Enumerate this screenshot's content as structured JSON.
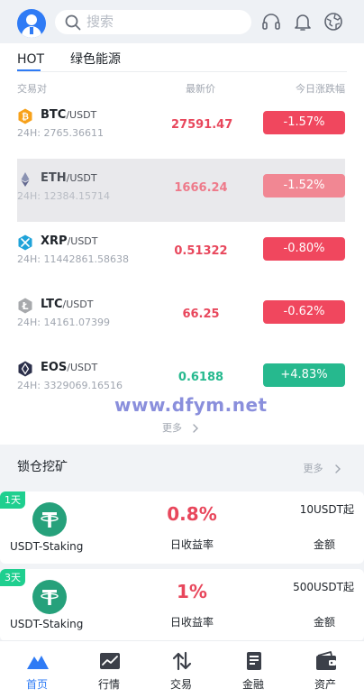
{
  "header": {
    "search_placeholder": "搜索",
    "icons": [
      "avatar",
      "search-icon",
      "headset-icon",
      "bell-icon",
      "globe-icon"
    ]
  },
  "market": {
    "tabs": [
      {
        "label": "HOT",
        "active": true
      },
      {
        "label": "绿色能源",
        "active": false
      }
    ],
    "columns": {
      "pair": "交易对",
      "price": "最新价",
      "change": "今日涨跌幅"
    },
    "rows": [
      {
        "symbol": "BTC",
        "quote": "/USDT",
        "volume": "24H: 2765.36611",
        "price": "27591.47",
        "change": "-1.57%",
        "direction": "down",
        "icon_color": "#f7a11a"
      },
      {
        "symbol": "ETH",
        "quote": "/USDT",
        "volume": "24H: 12384.15714",
        "price": "1666.24",
        "change": "-1.52%",
        "direction": "down",
        "icon_color": "#8a92b2"
      },
      {
        "symbol": "XRP",
        "quote": "/USDT",
        "volume": "24H: 11442861.58638",
        "price": "0.51322",
        "change": "-0.80%",
        "direction": "down",
        "icon_color": "#1fa3d9"
      },
      {
        "symbol": "LTC",
        "quote": "/USDT",
        "volume": "24H: 14161.07399",
        "price": "66.25",
        "change": "-0.62%",
        "direction": "down",
        "icon_color": "#a7a9ac"
      },
      {
        "symbol": "EOS",
        "quote": "/USDT",
        "volume": "24H: 3329069.16516",
        "price": "0.6188",
        "change": "+4.83%",
        "direction": "up",
        "icon_color": "#2b2f4a"
      }
    ],
    "more_label": "更多",
    "watermark": "www.dfym.net"
  },
  "staking": {
    "title": "锁仓挖矿",
    "more_label": "更多",
    "items": [
      {
        "tag": "1天",
        "name": "USDT-Staking",
        "rate": "0.8%",
        "rate_label": "日收益率",
        "min": "10USDT起",
        "min_label": "金额"
      },
      {
        "tag": "3天",
        "name": "USDT-Staking",
        "rate": "1%",
        "rate_label": "日收益率",
        "min": "500USDT起",
        "min_label": "金额"
      }
    ]
  },
  "nav": {
    "items": [
      {
        "label": "首页",
        "active": true
      },
      {
        "label": "行情",
        "active": false
      },
      {
        "label": "交易",
        "active": false
      },
      {
        "label": "金融",
        "active": false
      },
      {
        "label": "资产",
        "active": false
      }
    ]
  },
  "colors": {
    "accent": "#2f7bf5",
    "down": "#f0475e",
    "up": "#26b98e",
    "tag": "#1fcf8f"
  }
}
